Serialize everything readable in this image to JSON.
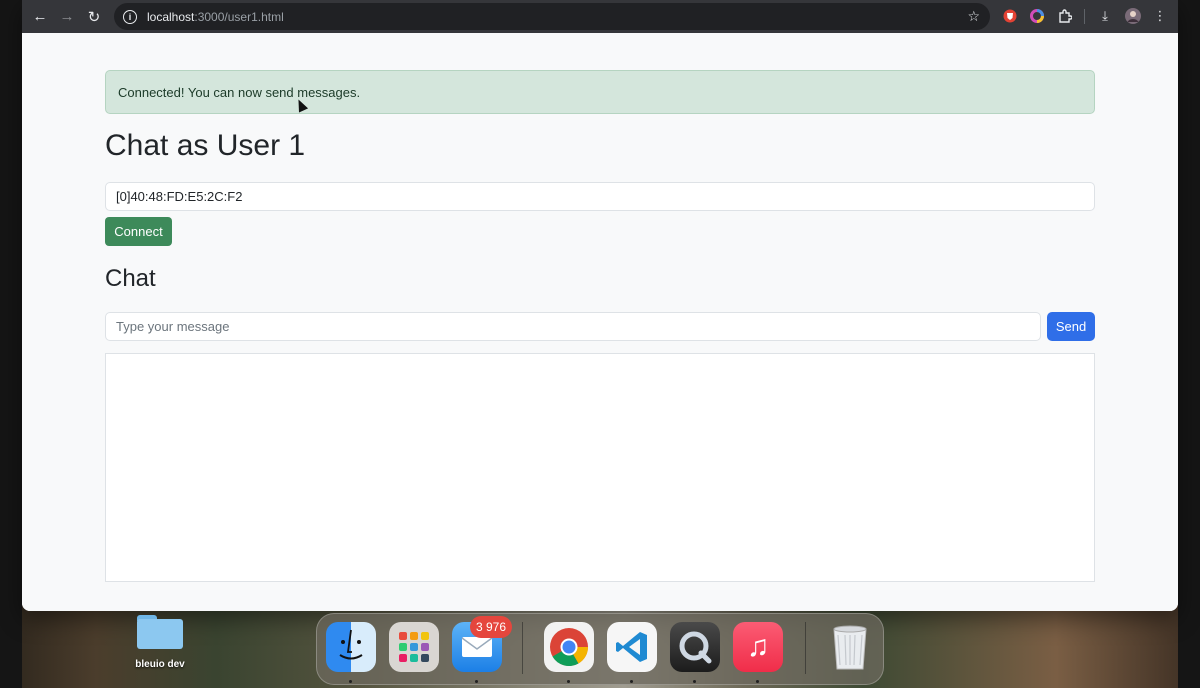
{
  "browser": {
    "url_host": "localhost",
    "url_path": ":3000/user1.html",
    "back_icon": "←",
    "forward_icon": "→",
    "reload_icon": "↻",
    "info_icon": "i",
    "star_icon": "☆",
    "menu_icon": "⋮",
    "download_icon": "⤓"
  },
  "page": {
    "alert_text": "Connected! You can now send messages.",
    "title": "Chat as User 1",
    "device_address_value": "[0]40:48:FD:E5:2C:F2",
    "connect_label": "Connect",
    "chat_heading": "Chat",
    "message_placeholder": "Type your message",
    "send_label": "Send"
  },
  "desktop": {
    "folder_label": "bleuio dev"
  },
  "dock": {
    "mail_badge": "3 976",
    "music_glyph": "♫",
    "trash_glyph": "🗑"
  },
  "colors": {
    "alert_bg": "#d4e6dc",
    "connect_btn": "#3d8a5a",
    "send_btn": "#2f6ee8",
    "badge": "#e5463d"
  }
}
